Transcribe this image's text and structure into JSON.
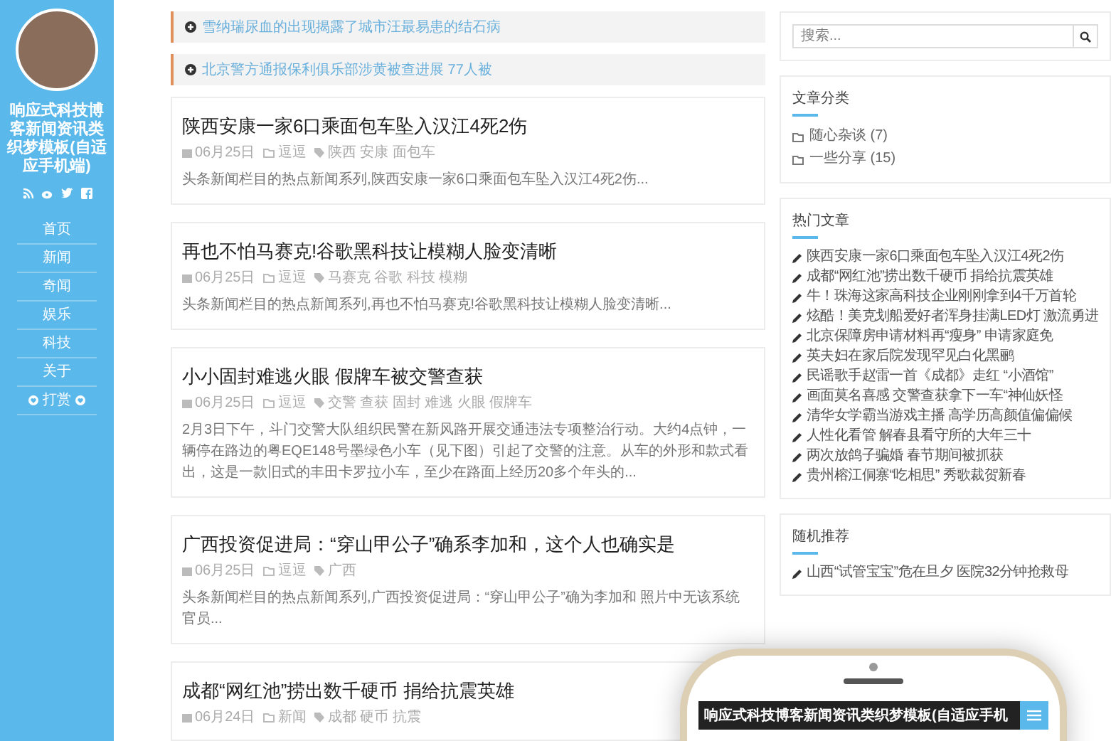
{
  "sidebar": {
    "site_title": "响应式科技博客新闻资讯类织梦模板(自适应手机端)",
    "menu": [
      {
        "label": "首页",
        "kind": "link"
      },
      {
        "label": "新闻",
        "kind": "link"
      },
      {
        "label": "奇闻",
        "kind": "link"
      },
      {
        "label": "娱乐",
        "kind": "link"
      },
      {
        "label": "科技",
        "kind": "link"
      },
      {
        "label": "关于",
        "kind": "link"
      },
      {
        "label": "打赏",
        "kind": "donate"
      }
    ]
  },
  "notices": [
    "雪纳瑞尿血的出现揭露了城市汪最易患的结石病",
    "北京警方通报保利俱乐部涉黄被查进展 77人被"
  ],
  "articles": [
    {
      "title": "陕西安康一家6口乘面包车坠入汉江4死2伤",
      "date": "06月25日",
      "category": "逗逗",
      "tags": "陕西 安康 面包车",
      "excerpt": "头条新闻栏目的热点新闻系列,陕西安康一家6口乘面包车坠入汉江4死2伤..."
    },
    {
      "title": "再也不怕马赛克!谷歌黑科技让模糊人脸变清晰",
      "date": "06月25日",
      "category": "逗逗",
      "tags": "马赛克 谷歌 科技 模糊",
      "excerpt": "头条新闻栏目的热点新闻系列,再也不怕马赛克!谷歌黑科技让模糊人脸变清晰..."
    },
    {
      "title": "小小固封难逃火眼 假牌车被交警查获",
      "date": "06月25日",
      "category": "逗逗",
      "tags": "交警 查获 固封 难逃 火眼 假牌车",
      "excerpt": "2月3日下午，斗门交警大队组织民警在新风路开展交通违法专项整治行动。大约4点钟，一辆停在路边的粤EQE148号墨绿色小车（见下图）引起了交警的注意。从车的外形和款式看出，这是一款旧式的丰田卡罗拉小车，至少在路面上经历20多个年头的..."
    },
    {
      "title": "广西投资促进局：“穿山甲公子”确系李加和，这个人也确实是",
      "date": "06月25日",
      "category": "逗逗",
      "tags": "广西",
      "excerpt": "头条新闻栏目的热点新闻系列,广西投资促进局：“穿山甲公子”确为李加和 照片中无该系统官员..."
    },
    {
      "title": "成都“网红池”捞出数千硬币 捐给抗震英雄",
      "date": "06月24日",
      "category": "新闻",
      "tags": "成都 硬币 抗震"
    }
  ],
  "search": {
    "placeholder": "搜索..."
  },
  "categories": {
    "title": "文章分类",
    "items": [
      {
        "label": "随心杂谈",
        "count": "(7)"
      },
      {
        "label": "一些分享",
        "count": "(15)"
      }
    ]
  },
  "hot": {
    "title": "热门文章",
    "items": [
      "陕西安康一家6口乘面包车坠入汉江4死2伤",
      "成都“网红池”捞出数千硬币 捐给抗震英雄",
      "牛！珠海这家高科技企业刚刚拿到4千万首轮",
      "炫酷！美克划船爱好者浑身挂满LED灯 激流勇进",
      "北京保障房申请材料再“瘦身” 申请家庭免",
      "英夫妇在家后院发现罕见白化黑鹂",
      "民谣歌手赵雷一首《成都》走红 “小酒馆”",
      "画面莫名喜感 交警查获拿下一车“神仙妖怪",
      "清华女学霸当游戏主播 高学历高颜值偏偏候",
      "人性化看管 解春县看守所的大年三十",
      "两次放鸽子骗婚 春节期间被抓获",
      "贵州榕江侗寨“吃相思” 秀歌裁贺新春"
    ]
  },
  "random": {
    "title": "随机推荐",
    "items": [
      "山西“试管宝宝”危在旦夕 医院32分钟抢救母"
    ]
  },
  "phone": {
    "title": "响应式科技博客新闻资讯类织梦模板(自适应手机"
  }
}
